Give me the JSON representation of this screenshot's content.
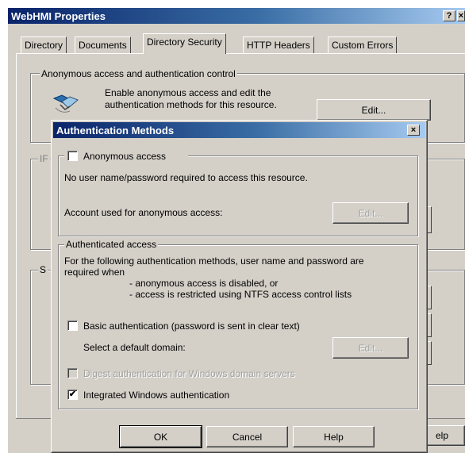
{
  "properties_window": {
    "title": "WebHMI Properties",
    "help_button": "?",
    "close_glyph": "×",
    "tabs": [
      "Directory",
      "Documents",
      "Directory Security",
      "HTTP Headers",
      "Custom Errors"
    ],
    "active_tab": "Directory Security",
    "anon_group": {
      "legend": "Anonymous access and authentication control",
      "description_line1": "Enable anonymous access and edit the",
      "description_line2": "authentication methods for this resource.",
      "edit_button": "Edit..."
    },
    "ip_group_legend_fragment": "IF",
    "secure_group_legend_fragment": "S",
    "help_fragment": "elp"
  },
  "auth_dialog": {
    "title": "Authentication Methods",
    "close_glyph": "×",
    "anonymous": {
      "checkbox_label": "Anonymous access",
      "checked": false,
      "description": "No user name/password required to access this resource.",
      "account_label": "Account used for anonymous access:",
      "edit_button": "Edit..."
    },
    "authenticated": {
      "legend": "Authenticated access",
      "intro_line1": "For the following authentication methods, user name and password are",
      "intro_line2": "required when",
      "bullet1": "- anonymous access is disabled, or",
      "bullet2": "- access is restricted using NTFS access control lists",
      "basic_label": "Basic authentication (password is sent in clear text)",
      "basic_checked": false,
      "default_domain_label": "Select a default domain:",
      "domain_edit_button": "Edit...",
      "digest_label": "Digest authentication for Windows domain servers",
      "digest_checked": false,
      "integrated_label": "Integrated Windows authentication",
      "integrated_checked": true,
      "check_glyph": "✔"
    },
    "buttons": {
      "ok": "OK",
      "cancel": "Cancel",
      "help": "Help"
    }
  }
}
